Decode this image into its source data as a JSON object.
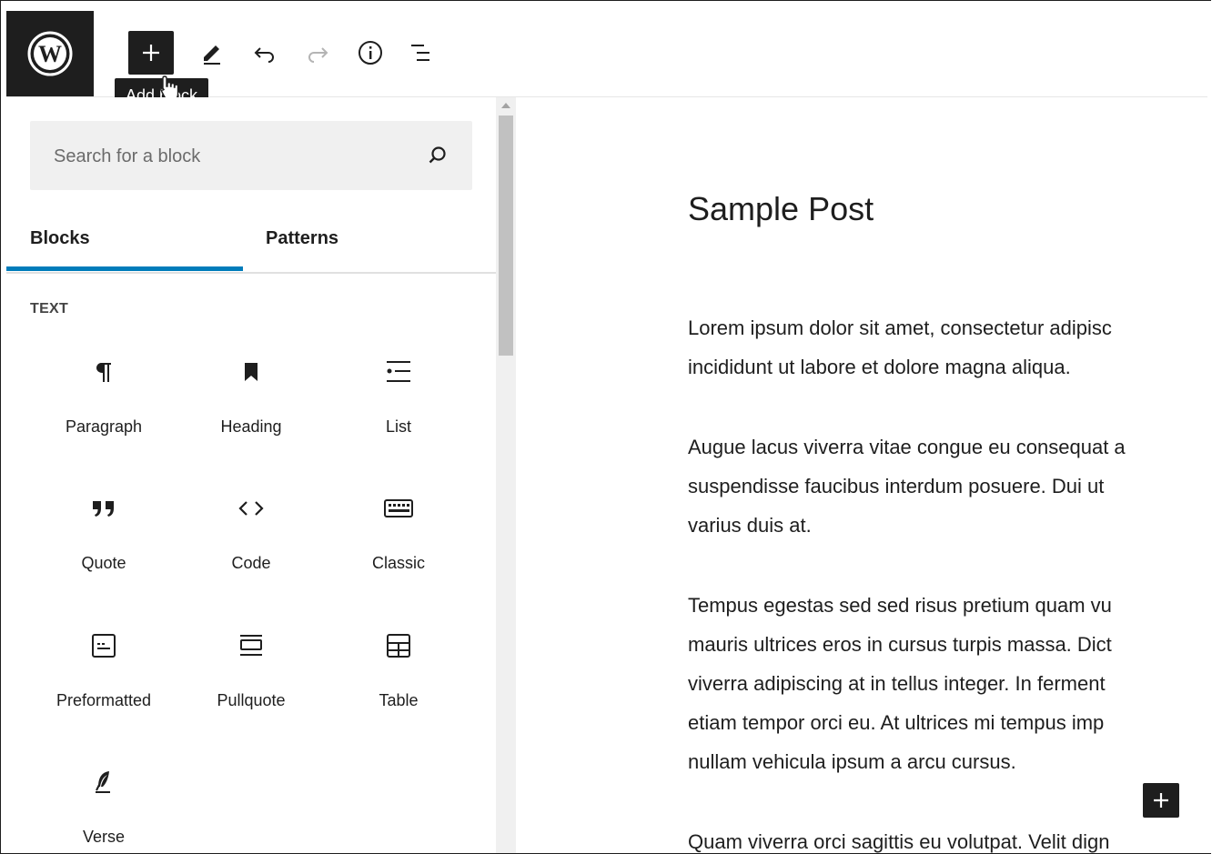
{
  "toolbar": {
    "logo_icon": "wordpress-logo-icon",
    "add_block_icon": "plus-icon",
    "tooltip": "Add block",
    "tools_icon": "pencil-icon",
    "undo_icon": "undo-icon",
    "redo_icon": "redo-icon",
    "details_icon": "info-icon",
    "outline_icon": "list-view-icon"
  },
  "inserter": {
    "search": {
      "placeholder": "Search for a block",
      "value": ""
    },
    "tabs": [
      {
        "label": "Blocks",
        "active": true
      },
      {
        "label": "Patterns",
        "active": false
      }
    ],
    "section_label": "TEXT",
    "blocks": [
      {
        "label": "Paragraph",
        "icon": "paragraph-icon"
      },
      {
        "label": "Heading",
        "icon": "bookmark-icon"
      },
      {
        "label": "List",
        "icon": "list-icon"
      },
      {
        "label": "Quote",
        "icon": "quote-icon"
      },
      {
        "label": "Code",
        "icon": "code-icon"
      },
      {
        "label": "Classic",
        "icon": "keyboard-icon"
      },
      {
        "label": "Preformatted",
        "icon": "preformatted-icon"
      },
      {
        "label": "Pullquote",
        "icon": "pullquote-icon"
      },
      {
        "label": "Table",
        "icon": "table-icon"
      },
      {
        "label": "Verse",
        "icon": "feather-icon"
      }
    ]
  },
  "editor": {
    "title": "Sample Post",
    "paragraphs": [
      [
        "Lorem ipsum dolor sit amet, consectetur adipisc",
        "incididunt ut labore et dolore magna aliqua."
      ],
      [
        "Augue lacus viverra vitae congue eu consequat a",
        "suspendisse faucibus interdum posuere. Dui ut",
        "varius duis at."
      ],
      [
        "Tempus egestas sed sed risus pretium quam vu",
        "mauris ultrices eros in cursus turpis massa. Dict",
        "viverra adipiscing at in tellus integer. In ferment",
        "etiam tempor orci eu. At ultrices mi tempus imp",
        "nullam vehicula ipsum a arcu cursus."
      ],
      [
        "Quam viverra orci sagittis eu volutpat. Velit dign"
      ]
    ],
    "inline_inserter_icon": "plus-icon"
  },
  "colors": {
    "dark": "#1e1e1e",
    "accent": "#007cba",
    "panel_bg": "#f0f0f0"
  }
}
